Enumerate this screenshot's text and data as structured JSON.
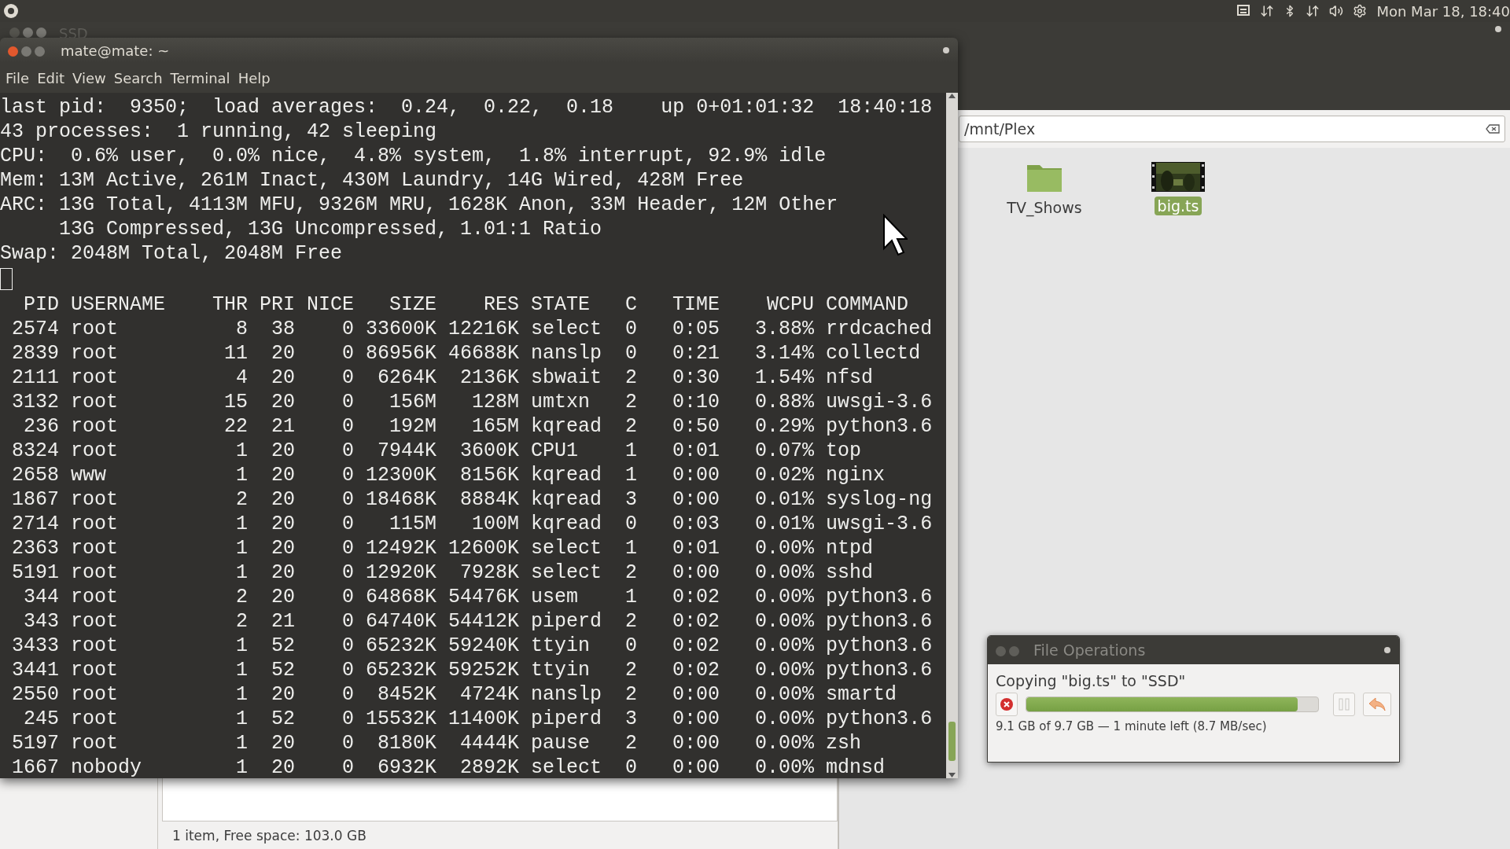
{
  "top_panel": {
    "clock": "Mon Mar 18, 18:40"
  },
  "file_manager": {
    "title": "SSD",
    "location": "/mnt/Plex",
    "items": [
      {
        "name": "TV_Shows",
        "kind": "folder",
        "selected": false
      },
      {
        "name": "big.ts",
        "kind": "video",
        "selected": true
      }
    ],
    "status": "1 item, Free space: 103.0 GB"
  },
  "terminal": {
    "title": "mate@mate: ~",
    "menu": [
      "File",
      "Edit",
      "View",
      "Search",
      "Terminal",
      "Help"
    ],
    "summary": [
      "last pid:  9350;  load averages:  0.24,  0.22,  0.18    up 0+01:01:32  18:40:18",
      "43 processes:  1 running, 42 sleeping",
      "CPU:  0.6% user,  0.0% nice,  4.8% system,  1.8% interrupt, 92.9% idle",
      "Mem: 13M Active, 261M Inact, 430M Laundry, 14G Wired, 428M Free",
      "ARC: 13G Total, 4113M MFU, 9326M MRU, 1628K Anon, 33M Header, 12M Other",
      "     13G Compressed, 13G Uncompressed, 1.01:1 Ratio",
      "Swap: 2048M Total, 2048M Free"
    ],
    "table": {
      "columns": [
        "PID",
        "USERNAME",
        "THR",
        "PRI",
        "NICE",
        "SIZE",
        "RES",
        "STATE",
        "C",
        "TIME",
        "WCPU",
        "COMMAND"
      ],
      "rows": [
        [
          "2574",
          "root",
          "8",
          "38",
          "0",
          "33600K",
          "12216K",
          "select",
          "0",
          "0:05",
          "3.88%",
          "rrdcached"
        ],
        [
          "2839",
          "root",
          "11",
          "20",
          "0",
          "86956K",
          "46688K",
          "nanslp",
          "0",
          "0:21",
          "3.14%",
          "collectd"
        ],
        [
          "2111",
          "root",
          "4",
          "20",
          "0",
          "6264K",
          "2136K",
          "sbwait",
          "2",
          "0:30",
          "1.54%",
          "nfsd"
        ],
        [
          "3132",
          "root",
          "15",
          "20",
          "0",
          "156M",
          "128M",
          "umtxn",
          "2",
          "0:10",
          "0.88%",
          "uwsgi-3.6"
        ],
        [
          "236",
          "root",
          "22",
          "21",
          "0",
          "192M",
          "165M",
          "kqread",
          "2",
          "0:50",
          "0.29%",
          "python3.6"
        ],
        [
          "8324",
          "root",
          "1",
          "20",
          "0",
          "7944K",
          "3600K",
          "CPU1",
          "1",
          "0:01",
          "0.07%",
          "top"
        ],
        [
          "2658",
          "www",
          "1",
          "20",
          "0",
          "12300K",
          "8156K",
          "kqread",
          "1",
          "0:00",
          "0.02%",
          "nginx"
        ],
        [
          "1867",
          "root",
          "2",
          "20",
          "0",
          "18468K",
          "8884K",
          "kqread",
          "3",
          "0:00",
          "0.01%",
          "syslog-ng"
        ],
        [
          "2714",
          "root",
          "1",
          "20",
          "0",
          "115M",
          "100M",
          "kqread",
          "0",
          "0:03",
          "0.01%",
          "uwsgi-3.6"
        ],
        [
          "2363",
          "root",
          "1",
          "20",
          "0",
          "12492K",
          "12600K",
          "select",
          "1",
          "0:01",
          "0.00%",
          "ntpd"
        ],
        [
          "5191",
          "root",
          "1",
          "20",
          "0",
          "12920K",
          "7928K",
          "select",
          "2",
          "0:00",
          "0.00%",
          "sshd"
        ],
        [
          "344",
          "root",
          "2",
          "20",
          "0",
          "64868K",
          "54476K",
          "usem",
          "1",
          "0:02",
          "0.00%",
          "python3.6"
        ],
        [
          "343",
          "root",
          "2",
          "21",
          "0",
          "64740K",
          "54412K",
          "piperd",
          "2",
          "0:02",
          "0.00%",
          "python3.6"
        ],
        [
          "3433",
          "root",
          "1",
          "52",
          "0",
          "65232K",
          "59240K",
          "ttyin",
          "0",
          "0:02",
          "0.00%",
          "python3.6"
        ],
        [
          "3441",
          "root",
          "1",
          "52",
          "0",
          "65232K",
          "59252K",
          "ttyin",
          "2",
          "0:02",
          "0.00%",
          "python3.6"
        ],
        [
          "2550",
          "root",
          "1",
          "20",
          "0",
          "8452K",
          "4724K",
          "nanslp",
          "2",
          "0:00",
          "0.00%",
          "smartd"
        ],
        [
          "245",
          "root",
          "1",
          "52",
          "0",
          "15532K",
          "11400K",
          "piperd",
          "3",
          "0:00",
          "0.00%",
          "python3.6"
        ],
        [
          "5197",
          "root",
          "1",
          "20",
          "0",
          "8180K",
          "4444K",
          "pause",
          "2",
          "0:00",
          "0.00%",
          "zsh"
        ],
        [
          "1667",
          "nobody",
          "1",
          "20",
          "0",
          "6932K",
          "2892K",
          "select",
          "0",
          "0:00",
          "0.00%",
          "mdnsd"
        ]
      ]
    }
  },
  "file_operations": {
    "title": "File Operations",
    "message": "Copying \"big.ts\" to \"SSD\"",
    "level": 0.93,
    "details": "9.1 GB of 9.7 GB — 1 minute left (8.7 MB/sec)"
  }
}
